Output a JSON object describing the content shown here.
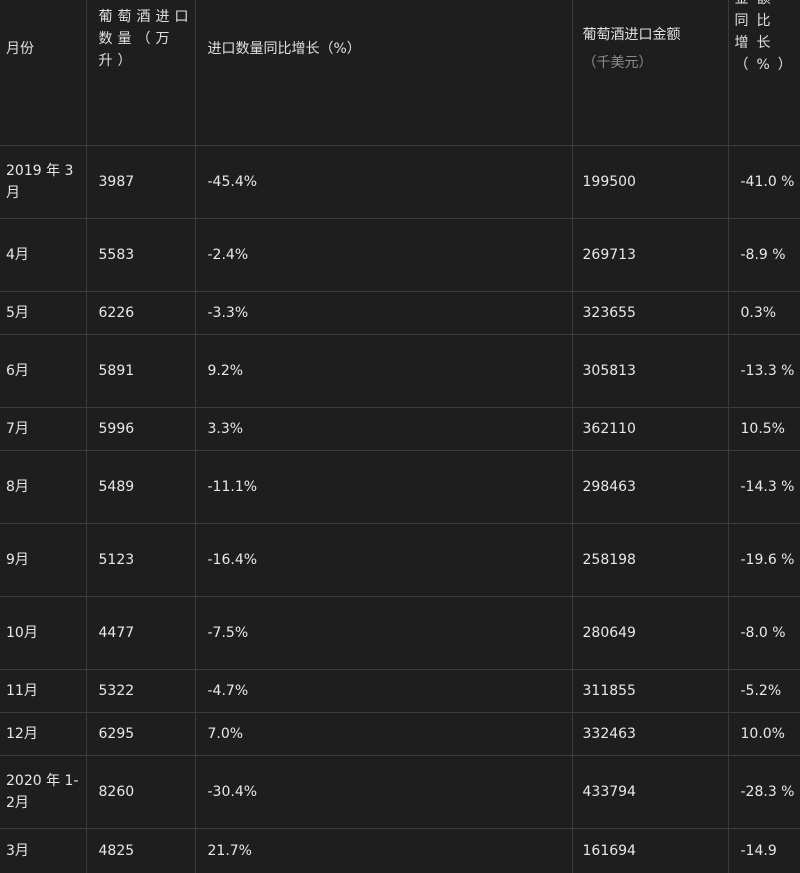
{
  "headers": {
    "month": "月份",
    "quantity": "葡萄酒进口数量（万升）",
    "quantity_yoy": "进口数量同比增长（%）",
    "amount": "葡萄酒进口金额",
    "amount_unit": "（千美元）",
    "amount_yoy": "金额同比增长（%）"
  },
  "rows": [
    {
      "month": "2019 年 3月",
      "quantity": "3987",
      "quantity_yoy": "-45.4%",
      "amount": "199500",
      "amount_yoy": "-41.0 %"
    },
    {
      "month": "4月",
      "quantity": "5583",
      "quantity_yoy": "-2.4%",
      "amount": "269713",
      "amount_yoy": "-8.9 %"
    },
    {
      "month": "5月",
      "quantity": "6226",
      "quantity_yoy": "-3.3%",
      "amount": "323655",
      "amount_yoy": "0.3%"
    },
    {
      "month": "6月",
      "quantity": "5891",
      "quantity_yoy": "9.2%",
      "amount": "305813",
      "amount_yoy": "-13.3 %"
    },
    {
      "month": "7月",
      "quantity": "5996",
      "quantity_yoy": "3.3%",
      "amount": "362110",
      "amount_yoy": "10.5%"
    },
    {
      "month": "8月",
      "quantity": "5489",
      "quantity_yoy": "-11.1%",
      "amount": "298463",
      "amount_yoy": "-14.3 %"
    },
    {
      "month": "9月",
      "quantity": "5123",
      "quantity_yoy": "-16.4%",
      "amount": "258198",
      "amount_yoy": "-19.6 %"
    },
    {
      "month": "10月",
      "quantity": "4477",
      "quantity_yoy": "-7.5%",
      "amount": "280649",
      "amount_yoy": "-8.0 %"
    },
    {
      "month": "11月",
      "quantity": "5322",
      "quantity_yoy": "-4.7%",
      "amount": "311855",
      "amount_yoy": "-5.2%"
    },
    {
      "month": "12月",
      "quantity": "6295",
      "quantity_yoy": "7.0%",
      "amount": "332463",
      "amount_yoy": "10.0%"
    },
    {
      "month": "2020 年 1-2月",
      "quantity": "8260",
      "quantity_yoy": "-30.4%",
      "amount": "433794",
      "amount_yoy": "-28.3 %"
    },
    {
      "month": "3月",
      "quantity": "4825",
      "quantity_yoy": "21.7%",
      "amount": "161694",
      "amount_yoy": "-14.9"
    }
  ]
}
